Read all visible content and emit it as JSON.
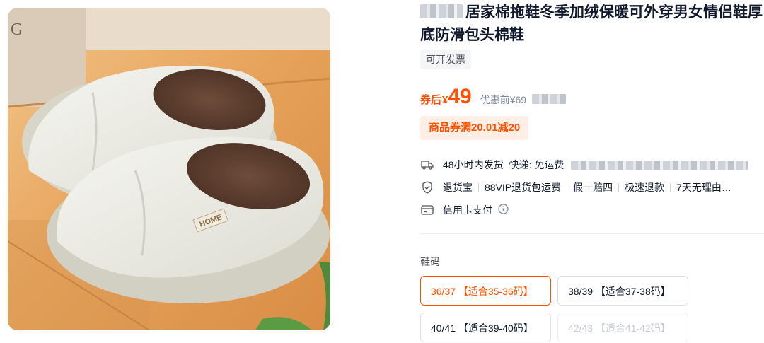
{
  "product": {
    "title": "居家棉拖鞋冬季加绒保暖可外穿男女情侣鞋厚底防滑包头棉鞋",
    "image_alt": "白色棉拖鞋",
    "image_tag_text": "HOME"
  },
  "invoice_tag": "可开发票",
  "price": {
    "prefix": "券后",
    "currency": "¥",
    "value": "49",
    "original": "优惠前¥69"
  },
  "coupon": "商品券满20.01减20",
  "services": {
    "shipping": "48小时内发货",
    "express": "快递: 免运费",
    "guarantees": [
      "退货宝",
      "88VIP退货包运费",
      "假一赔四",
      "极速退款",
      "7天无理由…"
    ],
    "payment": "信用卡支付"
  },
  "sizes": {
    "label": "鞋码",
    "options": [
      {
        "label": "36/37 【适合35-36码】",
        "state": "selected"
      },
      {
        "label": "38/39 【适合37-38码】",
        "state": "normal"
      },
      {
        "label": "40/41 【适合39-40码】",
        "state": "normal"
      },
      {
        "label": "42/43 【适合41-42码】",
        "state": "disabled"
      }
    ]
  },
  "colors": {
    "accent": "#ff5000",
    "text": "#11192d",
    "muted": "#7c889c"
  },
  "icons": [
    "truck-icon",
    "shield-icon",
    "card-icon",
    "info-icon"
  ]
}
